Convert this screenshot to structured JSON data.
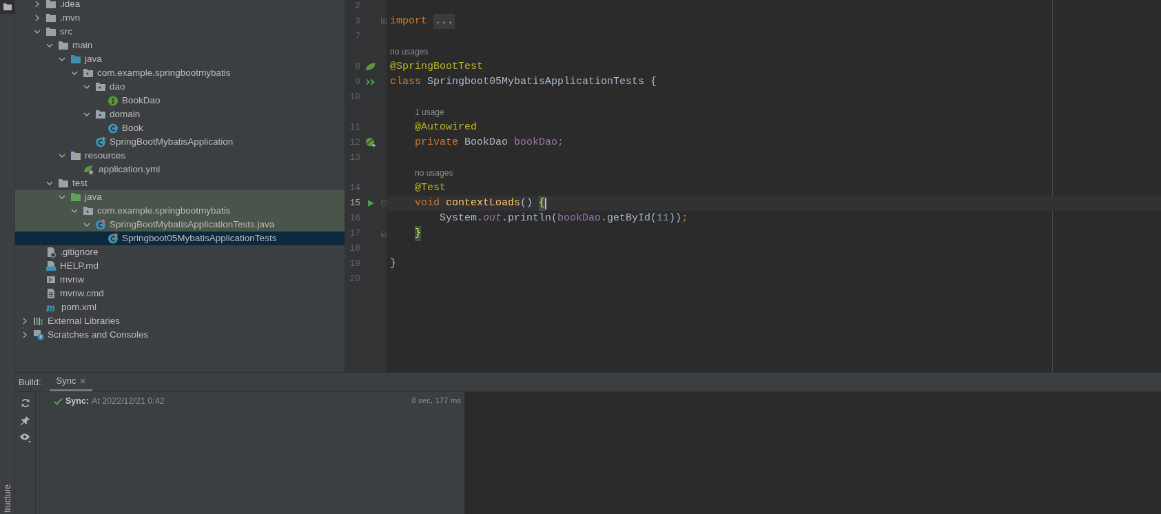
{
  "tool_strip": {
    "label": "tructure"
  },
  "project_tree": {
    "project_items": [
      {
        "label": ".idea",
        "kind": "folder",
        "expanded": false,
        "selected": false,
        "highlighted": false
      },
      {
        "label": ".mvn",
        "kind": "folder",
        "expanded": false,
        "selected": false,
        "highlighted": false
      },
      {
        "label": "src",
        "kind": "folder",
        "expanded": true,
        "selected": false,
        "highlighted": false,
        "children": [
          {
            "label": "main",
            "kind": "folder",
            "expanded": true,
            "selected": false,
            "highlighted": false,
            "children": [
              {
                "label": "java",
                "kind": "source_folder",
                "expanded": true,
                "selected": false,
                "highlighted": false,
                "children": [
                  {
                    "label": "com.example.springbootmybatis",
                    "kind": "package",
                    "expanded": true,
                    "selected": false,
                    "highlighted": false,
                    "children": [
                      {
                        "label": "dao",
                        "kind": "package",
                        "expanded": true,
                        "selected": false,
                        "highlighted": false,
                        "children": [
                          {
                            "label": "BookDao",
                            "kind": "interface",
                            "selected": false,
                            "highlighted": false
                          }
                        ]
                      },
                      {
                        "label": "domain",
                        "kind": "package",
                        "expanded": true,
                        "selected": false,
                        "highlighted": false,
                        "children": [
                          {
                            "label": "Book",
                            "kind": "class",
                            "selected": false,
                            "highlighted": false
                          }
                        ]
                      },
                      {
                        "label": "SpringBootMybatisApplication",
                        "kind": "spring_class",
                        "selected": false,
                        "highlighted": false
                      }
                    ]
                  }
                ]
              },
              {
                "label": "resources",
                "kind": "resources_folder",
                "expanded": true,
                "selected": false,
                "highlighted": false,
                "children": [
                  {
                    "label": "application.yml",
                    "kind": "spring_config",
                    "selected": false,
                    "highlighted": false
                  }
                ]
              }
            ]
          },
          {
            "label": "test",
            "kind": "folder",
            "expanded": true,
            "selected": false,
            "highlighted": false,
            "children": [
              {
                "label": "java",
                "kind": "test_folder",
                "expanded": true,
                "selected": false,
                "highlighted": true,
                "children": [
                  {
                    "label": "com.example.springbootmybatis",
                    "kind": "package",
                    "expanded": true,
                    "selected": false,
                    "highlighted": true,
                    "children": [
                      {
                        "label": "SpringBootMybatisApplicationTests.java",
                        "kind": "test_class",
                        "expanded": true,
                        "selected": false,
                        "highlighted": true,
                        "children": [
                          {
                            "label": "Springboot05MybatisApplicationTests",
                            "kind": "test_class",
                            "selected": true,
                            "highlighted": false
                          }
                        ]
                      }
                    ]
                  }
                ]
              }
            ]
          }
        ]
      },
      {
        "label": ".gitignore",
        "kind": "ignore_file",
        "selected": false,
        "highlighted": false
      },
      {
        "label": "HELP.md",
        "kind": "markdown",
        "selected": false,
        "highlighted": false
      },
      {
        "label": "mvnw",
        "kind": "shell",
        "selected": false,
        "highlighted": false
      },
      {
        "label": "mvnw.cmd",
        "kind": "text_file",
        "selected": false,
        "highlighted": false
      },
      {
        "label": "pom.xml",
        "kind": "maven",
        "selected": false,
        "highlighted": false
      }
    ],
    "top_items": [
      {
        "label": "External Libraries",
        "kind": "libraries",
        "expanded": false,
        "selected": false,
        "highlighted": false
      },
      {
        "label": "Scratches and Consoles",
        "kind": "scratches",
        "expanded": false,
        "selected": false,
        "highlighted": false
      }
    ]
  },
  "editor": {
    "lines": [
      {
        "kind": "code",
        "number": "2",
        "current": false
      },
      {
        "kind": "code",
        "number": "3",
        "current": false,
        "fold_marker": {
          "kind": "expand"
        },
        "tokens": [
          {
            "kind": "keyword",
            "text": "import "
          },
          {
            "kind": "folded",
            "text": "..."
          }
        ]
      },
      {
        "kind": "code",
        "number": "7",
        "current": false
      },
      {
        "kind": "hint",
        "text": "no usages"
      },
      {
        "kind": "code",
        "number": "8",
        "current": false,
        "gutter_marker": {
          "kind": "spring_leaf"
        },
        "tokens": [
          {
            "kind": "annotation",
            "text": "@SpringBootTest"
          }
        ]
      },
      {
        "kind": "code",
        "number": "9",
        "current": false,
        "gutter_marker": {
          "kind": "run_all"
        },
        "tokens": [
          {
            "kind": "keyword",
            "text": "class "
          },
          {
            "kind": "plain",
            "text": "Springboot05MybatisApplicationTests {"
          }
        ]
      },
      {
        "kind": "code",
        "number": "10",
        "current": false
      },
      {
        "kind": "hint",
        "text": "1 usage"
      },
      {
        "kind": "code",
        "number": "11",
        "current": false,
        "tokens": [
          {
            "kind": "annotation",
            "text": "    @Autowired"
          }
        ]
      },
      {
        "kind": "code",
        "number": "12",
        "current": false,
        "gutter_marker": {
          "kind": "spring_bean"
        },
        "tokens": [
          {
            "kind": "keyword",
            "text": "    private "
          },
          {
            "kind": "plain",
            "text": "BookDao "
          },
          {
            "kind": "field",
            "text": "bookDao"
          },
          {
            "kind": "keyword",
            "text": ";"
          }
        ]
      },
      {
        "kind": "code",
        "number": "13",
        "current": false
      },
      {
        "kind": "hint",
        "text": "no usages"
      },
      {
        "kind": "code",
        "number": "14",
        "current": false,
        "tokens": [
          {
            "kind": "annotation",
            "text": "    @Test"
          }
        ]
      },
      {
        "kind": "code",
        "number": "15",
        "current": true,
        "gutter_marker": {
          "kind": "run"
        },
        "fold_marker": {
          "kind": "start"
        },
        "tokens": [
          {
            "kind": "keyword",
            "text": "    void "
          },
          {
            "kind": "method",
            "text": "contextLoads"
          },
          {
            "kind": "plain",
            "text": "() "
          },
          {
            "kind": "brace_match",
            "text": "{"
          }
        ]
      },
      {
        "kind": "code",
        "number": "16",
        "current": false,
        "tokens": [
          {
            "kind": "plain",
            "text": "        System."
          },
          {
            "kind": "static",
            "text": "out"
          },
          {
            "kind": "plain",
            "text": ".println("
          },
          {
            "kind": "field",
            "text": "bookDao"
          },
          {
            "kind": "plain",
            "text": ".getById("
          },
          {
            "kind": "number",
            "text": "11"
          },
          {
            "kind": "plain",
            "text": "))"
          },
          {
            "kind": "keyword",
            "text": ";"
          }
        ]
      },
      {
        "kind": "code",
        "number": "17",
        "current": false,
        "fold_marker": {
          "kind": "end"
        },
        "tokens": [
          {
            "kind": "brace_match",
            "text": "    }"
          }
        ]
      },
      {
        "kind": "code",
        "number": "18",
        "current": false
      },
      {
        "kind": "code",
        "number": "19",
        "current": false,
        "tokens": [
          {
            "kind": "plain",
            "text": "}"
          }
        ]
      },
      {
        "kind": "code",
        "number": "20",
        "current": false
      }
    ]
  },
  "build_panel": {
    "label": "Build:",
    "tabs": [
      {
        "label": "Sync",
        "selected": true
      }
    ],
    "tools": [
      {
        "kind": "refresh"
      },
      {
        "kind": "pin"
      },
      {
        "kind": "eye"
      }
    ],
    "results": [
      {
        "kind": "success",
        "title": "Sync:",
        "detail": "At 2022/12/21 0:42",
        "duration": "8 sec, 177 ms"
      }
    ]
  }
}
